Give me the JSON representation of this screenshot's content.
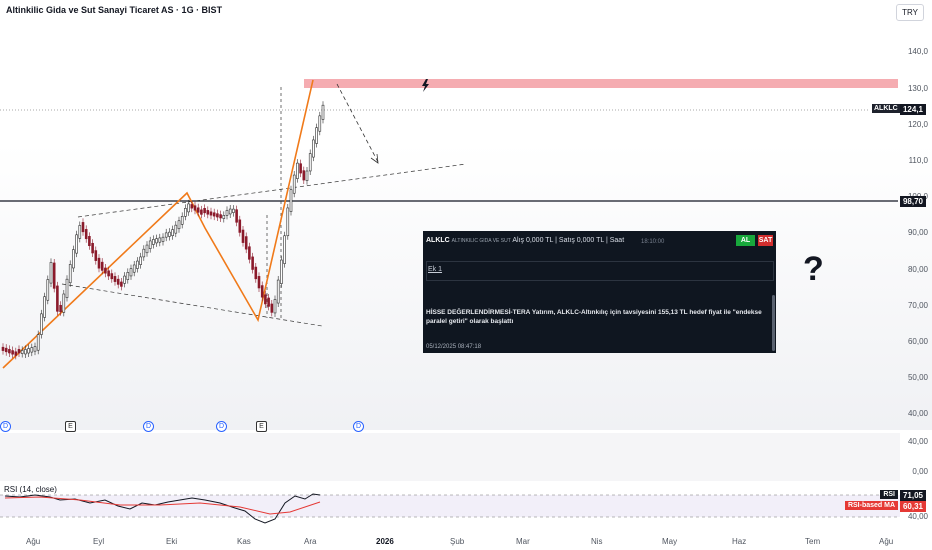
{
  "header": {
    "title": "Altinkilic Gida ve Sut Sanayi Ticaret AS · 1G · BIST",
    "currency": "TRY"
  },
  "price_axis": {
    "labels": [
      "140,0",
      "130,0",
      "120,0",
      "110,0",
      "100,0",
      "90,00",
      "80,00",
      "70,00",
      "60,00",
      "50,00",
      "40,00"
    ],
    "last_price": "124,1",
    "last_price_symbol": "ALKLC",
    "support_level": "98,70",
    "pane2_labels": [
      "40,00",
      "0,00"
    ],
    "rsi_value": "71,05",
    "rsi_ma_value": "60,31",
    "rsi_tag": "RSI",
    "rsi_ma_tag": "RSI-based MA",
    "rsi_level": "40,00"
  },
  "time_axis": {
    "labels": [
      "Ağu",
      "Eyl",
      "Eki",
      "Kas",
      "Ara",
      "2026",
      "Şub",
      "Mar",
      "Nis",
      "May",
      "Haz",
      "Tem",
      "Ağu"
    ]
  },
  "rsi_pane": {
    "label": "RSI (14, close)"
  },
  "event_markers": {
    "dividend": "D",
    "earnings": "E"
  },
  "news_panel": {
    "symbol": "ALKLC",
    "company": "ALTINKILIC GIDA VE SUT",
    "quote": "Alış 0,000 TL | Satış 0,000 TL | Saat",
    "time": "18:10:00",
    "buy_label": "AL",
    "sell_label": "SAT",
    "attachment": "Ek 1",
    "body": "HİSSE DEĞERLENDİRMESİ-TERA Yatırım, ALKLC-Altınkılıç için tavsiyesini 155,13 TL hedef fiyat ile \"endekse paralel getiri\" olarak başlattı",
    "timestamp": "05/12/2025 08:47:18"
  },
  "annotation": {
    "question_mark": "?",
    "lightning_icon": "lightning-icon"
  },
  "colors": {
    "resistance_zone": "#f4a3a8",
    "pattern_line": "#f07a1a",
    "rsi_line": "#131722",
    "rsi_ma_line": "#e53935",
    "buy": "#18a83c",
    "sell": "#d22e2e"
  }
}
